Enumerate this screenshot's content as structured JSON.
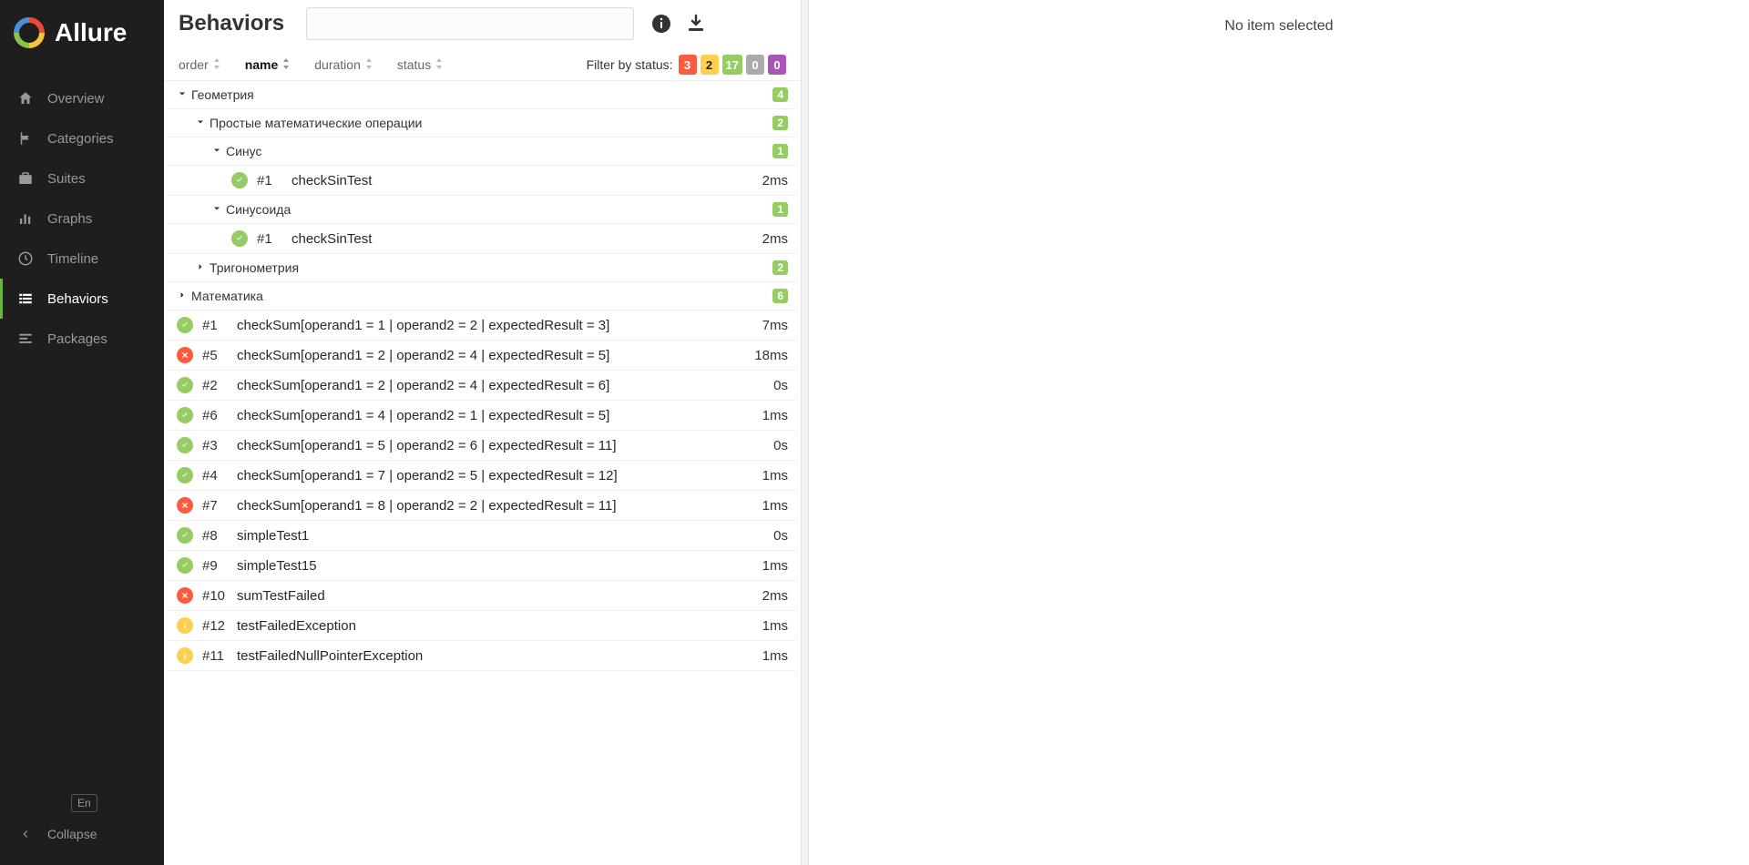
{
  "brand": "Allure",
  "nav": {
    "items": [
      {
        "icon": "home",
        "label": "Overview"
      },
      {
        "icon": "flag",
        "label": "Categories"
      },
      {
        "icon": "briefcase",
        "label": "Suites"
      },
      {
        "icon": "chart",
        "label": "Graphs"
      },
      {
        "icon": "clock",
        "label": "Timeline"
      },
      {
        "icon": "list",
        "label": "Behaviors"
      },
      {
        "icon": "align",
        "label": "Packages"
      }
    ],
    "active": 5,
    "lang": "En",
    "collapse": "Collapse"
  },
  "page": {
    "title": "Behaviors",
    "sorters": [
      "order",
      "name",
      "duration",
      "status"
    ],
    "sorter_active": "name",
    "filter_label": "Filter by status:",
    "status_counts": {
      "failed": "3",
      "broken": "2",
      "passed": "17",
      "skipped": "0",
      "unknown": "0"
    }
  },
  "tree": [
    {
      "type": "group",
      "level": 0,
      "open": true,
      "label": "Геометрия",
      "count": "4"
    },
    {
      "type": "group",
      "level": 1,
      "open": true,
      "label": "Простые математические операции",
      "count": "2"
    },
    {
      "type": "group",
      "level": 2,
      "open": true,
      "label": "Синус",
      "count": "1"
    },
    {
      "type": "test",
      "level": 3,
      "status": "passed",
      "num": "#1",
      "name": "checkSinTest",
      "dur": "2ms"
    },
    {
      "type": "group",
      "level": 2,
      "open": true,
      "label": "Синусоида",
      "count": "1"
    },
    {
      "type": "test",
      "level": 3,
      "status": "passed",
      "num": "#1",
      "name": "checkSinTest",
      "dur": "2ms"
    },
    {
      "type": "group",
      "level": 1,
      "open": false,
      "label": "Тригонометрия",
      "count": "2"
    },
    {
      "type": "group",
      "level": 0,
      "open": false,
      "label": "Математика",
      "count": "6"
    },
    {
      "type": "test",
      "level": 0,
      "status": "passed",
      "num": "#1",
      "name": "checkSum[operand1 = 1 | operand2 = 2 | expectedResult = 3]",
      "dur": "7ms"
    },
    {
      "type": "test",
      "level": 0,
      "status": "failed",
      "num": "#5",
      "name": "checkSum[operand1 = 2 | operand2 = 4 | expectedResult = 5]",
      "dur": "18ms"
    },
    {
      "type": "test",
      "level": 0,
      "status": "passed",
      "num": "#2",
      "name": "checkSum[operand1 = 2 | operand2 = 4 | expectedResult = 6]",
      "dur": "0s"
    },
    {
      "type": "test",
      "level": 0,
      "status": "passed",
      "num": "#6",
      "name": "checkSum[operand1 = 4 | operand2 = 1 | expectedResult = 5]",
      "dur": "1ms"
    },
    {
      "type": "test",
      "level": 0,
      "status": "passed",
      "num": "#3",
      "name": "checkSum[operand1 = 5 | operand2 = 6 | expectedResult = 11]",
      "dur": "0s"
    },
    {
      "type": "test",
      "level": 0,
      "status": "passed",
      "num": "#4",
      "name": "checkSum[operand1 = 7 | operand2 = 5 | expectedResult = 12]",
      "dur": "1ms"
    },
    {
      "type": "test",
      "level": 0,
      "status": "failed",
      "num": "#7",
      "name": "checkSum[operand1 = 8 | operand2 = 2 | expectedResult = 11]",
      "dur": "1ms"
    },
    {
      "type": "test",
      "level": 0,
      "status": "passed",
      "num": "#8",
      "name": "simpleTest1",
      "dur": "0s"
    },
    {
      "type": "test",
      "level": 0,
      "status": "passed",
      "num": "#9",
      "name": "simpleTest15",
      "dur": "1ms"
    },
    {
      "type": "test",
      "level": 0,
      "status": "failed",
      "num": "#10",
      "name": "sumTestFailed",
      "dur": "2ms"
    },
    {
      "type": "test",
      "level": 0,
      "status": "broken",
      "num": "#12",
      "name": "testFailedException",
      "dur": "1ms"
    },
    {
      "type": "test",
      "level": 0,
      "status": "broken",
      "num": "#11",
      "name": "testFailedNullPointerException",
      "dur": "1ms"
    }
  ],
  "detail": {
    "empty": "No item selected"
  }
}
